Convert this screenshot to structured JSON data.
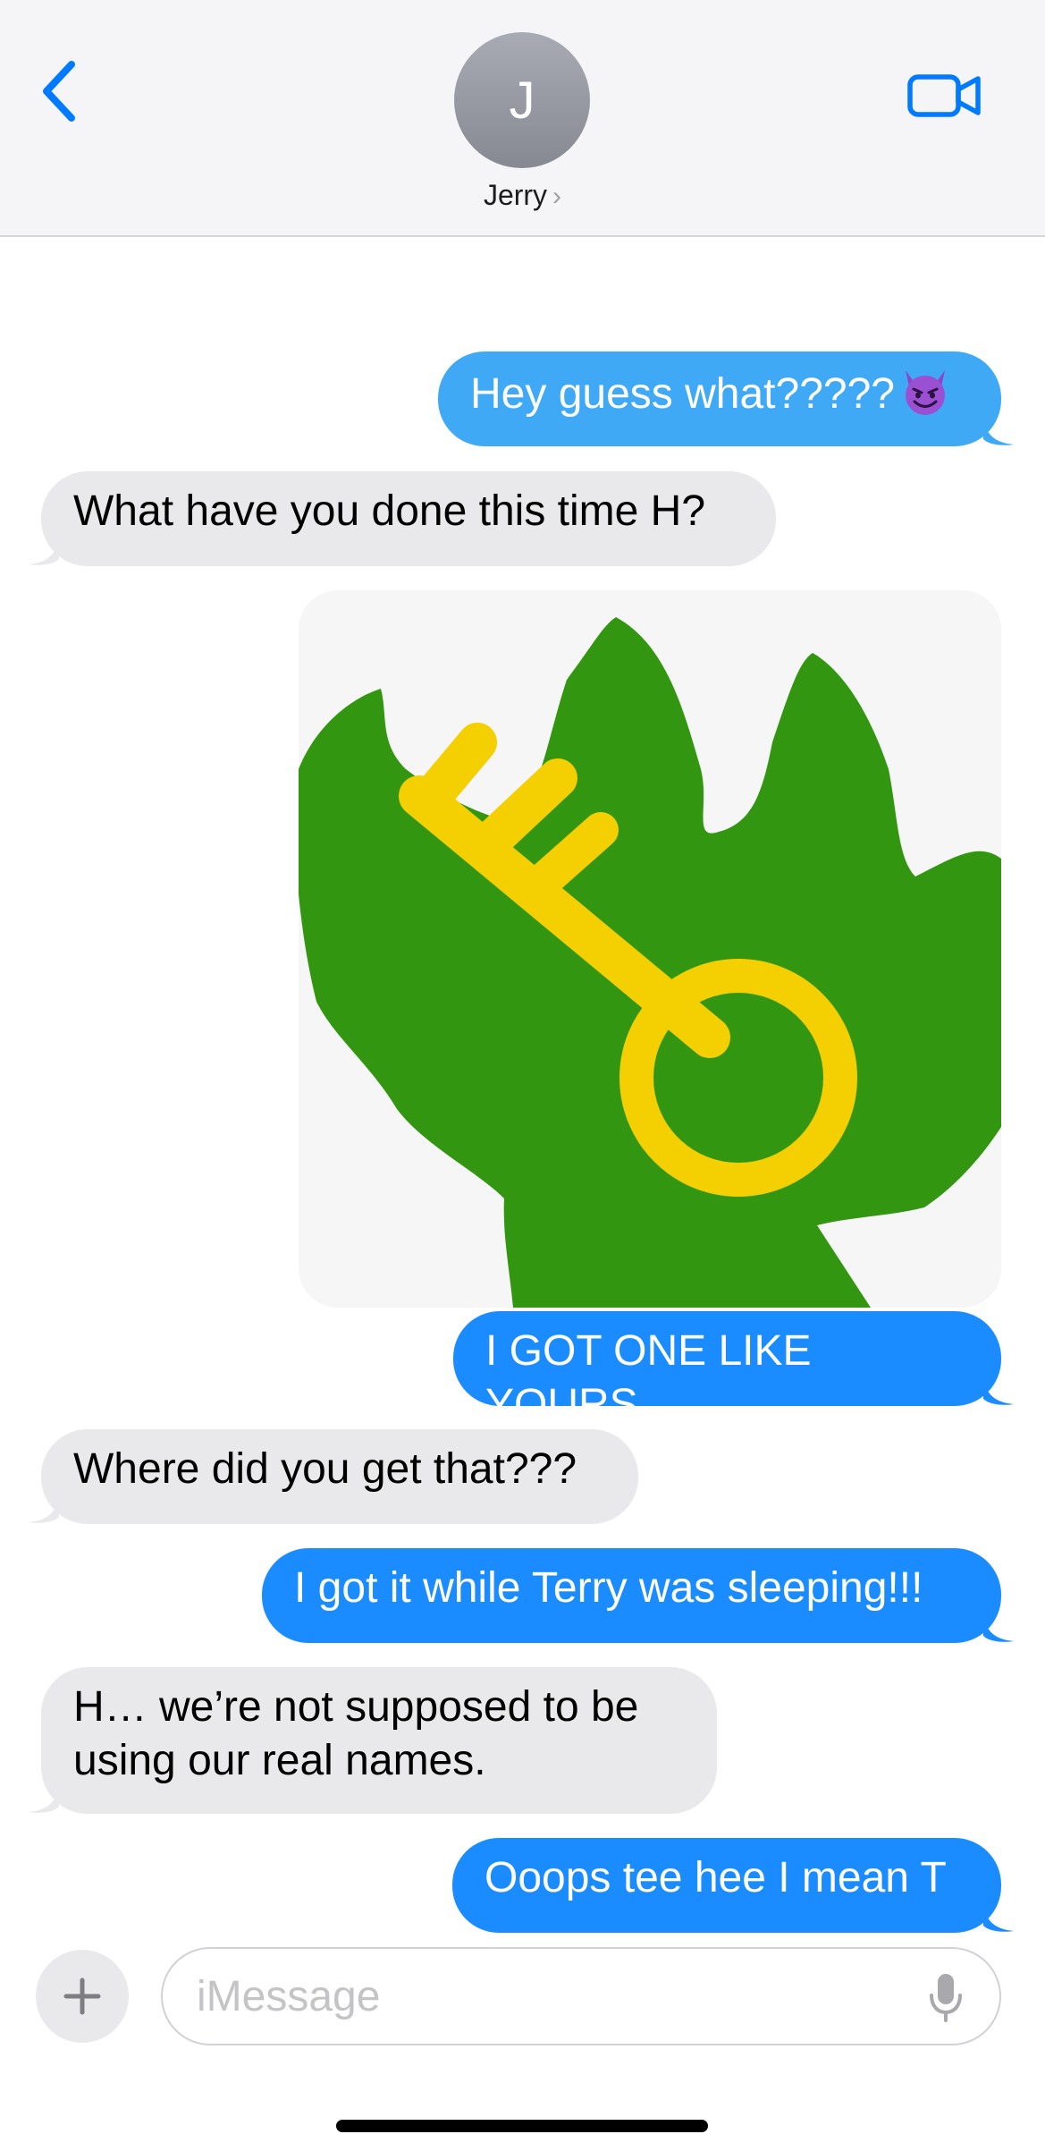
{
  "header": {
    "avatar_initial": "J",
    "contact_name": "Jerry",
    "contact_chevron": "›",
    "back_icon": "chevron-left-icon",
    "video_icon": "video-camera-icon"
  },
  "messages": [
    {
      "from": "me",
      "text": "Hey guess what?????",
      "emoji": "smiling-devil-emoji"
    },
    {
      "from": "them",
      "text": "What have you done this time H?"
    },
    {
      "from": "me",
      "type": "image",
      "image": "green-hand-holding-gold-key"
    },
    {
      "from": "me",
      "text": "I GOT ONE LIKE YOURS"
    },
    {
      "from": "them",
      "text": "Where did you get that???"
    },
    {
      "from": "me",
      "text": "I got it while Terry was sleeping!!!"
    },
    {
      "from": "them",
      "text_line1": "H… we’re not supposed to be",
      "text_line2": "using our real names."
    },
    {
      "from": "me",
      "text": "Ooops tee hee I mean T"
    }
  ],
  "composer": {
    "placeholder": "iMessage",
    "plus_icon": "plus-icon",
    "mic_icon": "microphone-icon"
  },
  "colors": {
    "header_bg": "#f5f5f7",
    "ios_blue": "#007aff",
    "sent_bubble": "#1a8cff",
    "sent_bubble_light": "#3fa9f5",
    "received_bubble": "#e9e9eb",
    "hand_green": "#339611",
    "key_gold": "#f4cf02"
  }
}
